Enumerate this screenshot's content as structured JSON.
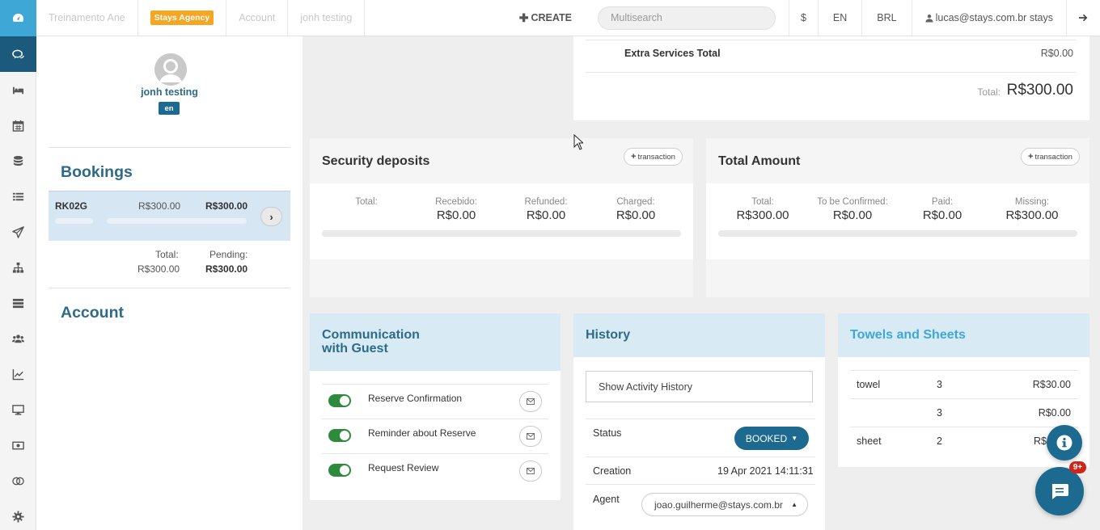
{
  "topbar": {
    "items": [
      "Treinamento Ane",
      "Account",
      "jonh testing"
    ],
    "agency_badge": "Stays Agency",
    "create": "CREATE",
    "search_placeholder": "Multisearch",
    "currency_symbol": "$",
    "language": "EN",
    "currency": "BRL",
    "user": "lucas@stays.com.br stays"
  },
  "guest": {
    "name": "jonh testing",
    "lang": "en",
    "bookings_title": "Bookings",
    "booking": {
      "code": "RK02G",
      "amount": "R$300.00",
      "amount_bold": "R$300.00"
    },
    "total_label": "Total:",
    "total_value": "R$300.00",
    "pending_label": "Pending:",
    "pending_value": "R$300.00",
    "account_title": "Account"
  },
  "extra": {
    "label": "Extra Services Total",
    "value": "R$0.00",
    "total_label": "Total:",
    "total_value": "R$300.00"
  },
  "security": {
    "title": "Security deposits",
    "button": "transaction",
    "stats": [
      {
        "label": "Total:",
        "value": ""
      },
      {
        "label": "Recebido:",
        "value": "R$0.00"
      },
      {
        "label": "Refunded:",
        "value": "R$0.00"
      },
      {
        "label": "Charged:",
        "value": "R$0.00"
      }
    ],
    "progress": 0
  },
  "total_amount": {
    "title": "Total Amount",
    "button": "transaction",
    "stats": [
      {
        "label": "Total:",
        "value": "R$300.00"
      },
      {
        "label": "To be Confirmed:",
        "value": "R$0.00"
      },
      {
        "label": "Paid:",
        "value": "R$0.00"
      },
      {
        "label": "Missing:",
        "value": "R$300.00"
      }
    ],
    "progress": 0
  },
  "communication": {
    "title_line1": "Communication",
    "title_line2": "with Guest",
    "items": [
      {
        "label": "Reserve Confirmation",
        "enabled": true
      },
      {
        "label": "Reminder about Reserve",
        "enabled": true
      },
      {
        "label": "Request Review",
        "enabled": true
      }
    ]
  },
  "history": {
    "title": "History",
    "show_activity": "Show Activity History",
    "status_label": "Status",
    "status_value": "BOOKED",
    "creation_label": "Creation",
    "creation_value": "19 Apr 2021 14:11:31",
    "agent_label": "Agent",
    "agent_value": "joao.guilherme@stays.com.br"
  },
  "towels": {
    "title": "Towels and Sheets",
    "rows": [
      {
        "name": "towel",
        "qty": "3",
        "price": "R$30.00"
      },
      {
        "name": "",
        "qty": "3",
        "price": "R$0.00"
      },
      {
        "name": "sheet",
        "qty": "2",
        "price": "R$"
      }
    ]
  },
  "chat": {
    "badge": "9+"
  },
  "colors": {
    "primary": "#1c6a8f",
    "accent": "#3fa7d6",
    "toggle_on": "#2e8b3e",
    "alert": "#d0261a",
    "agency": "#f5a623"
  },
  "icons": [
    "dashboard-icon",
    "chat-icon",
    "bed-icon",
    "calendar-icon",
    "database-icon",
    "list-icon",
    "send-icon",
    "sitemap-icon",
    "server-icon",
    "users-icon",
    "chart-icon",
    "monitor-icon",
    "money-icon",
    "circles-icon",
    "gear-icon",
    "info-icon",
    "message-icon",
    "mail-icon",
    "user-icon",
    "logout-icon"
  ]
}
